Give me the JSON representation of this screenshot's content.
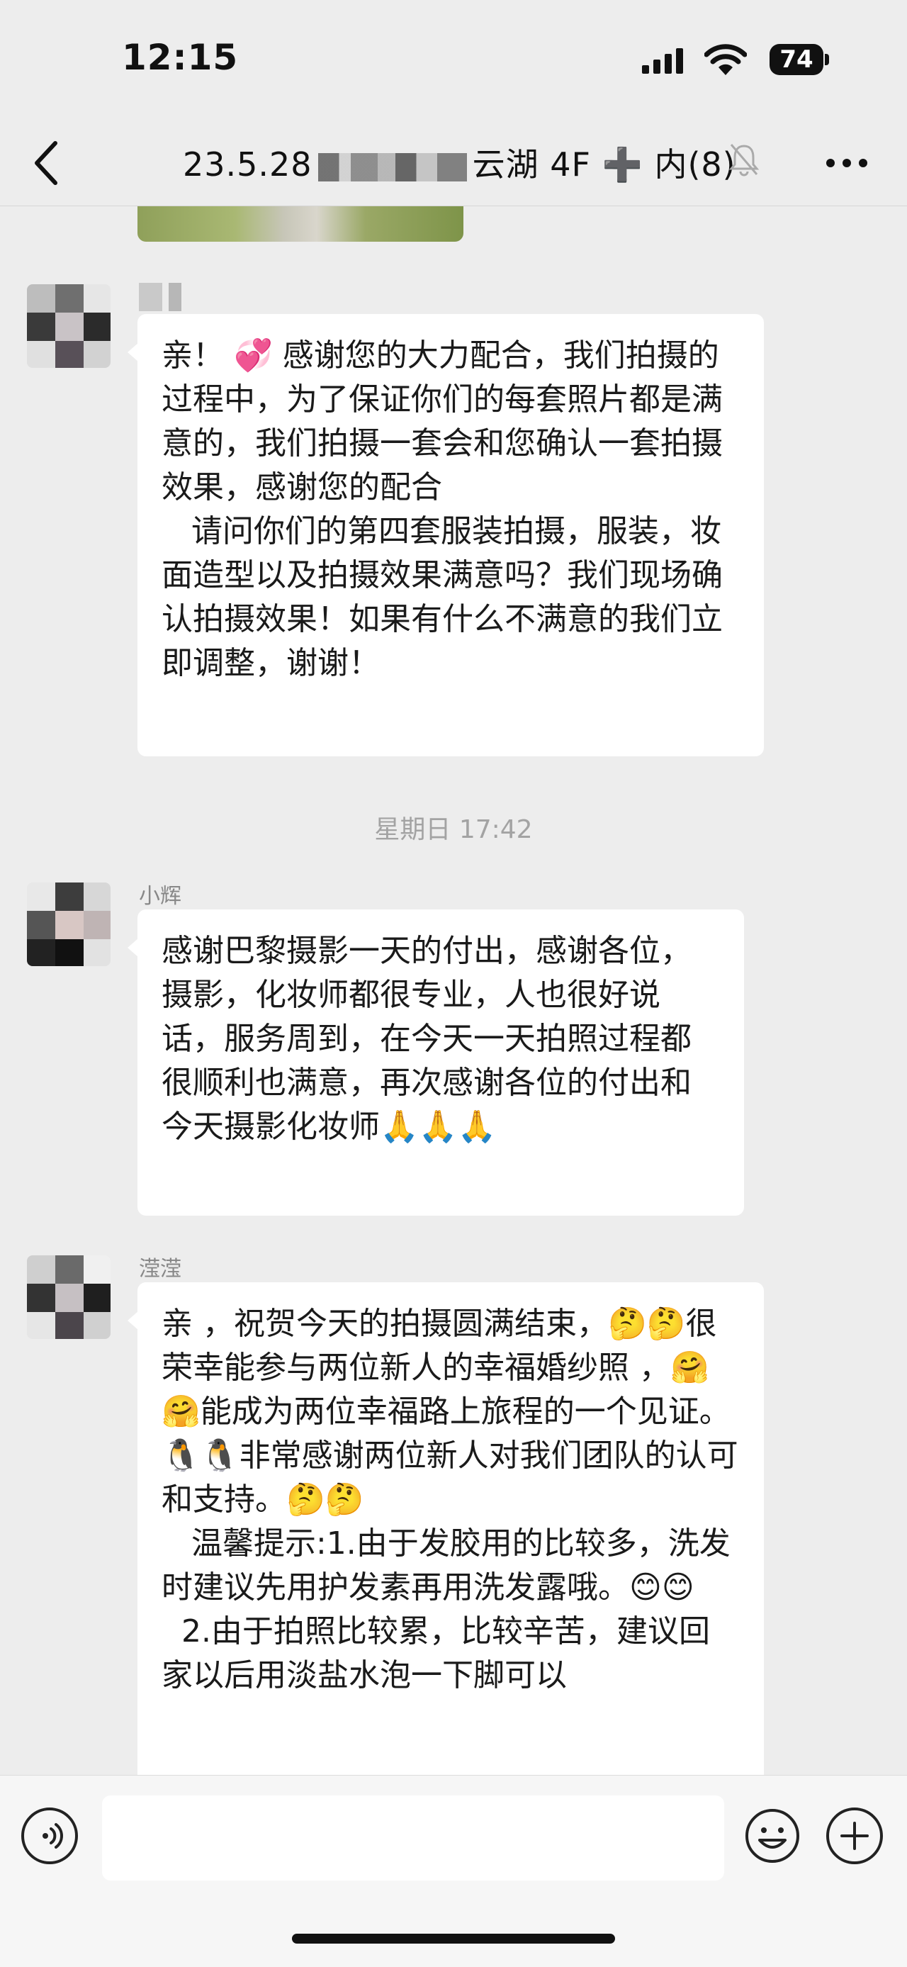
{
  "status_bar": {
    "time": "12:15",
    "battery": "74"
  },
  "nav": {
    "title_start": "23.5.28",
    "title_end": "云湖 4F ➕ 内(8)"
  },
  "messages": [
    {
      "sender": "",
      "text": "亲！ 💞 感谢您的大力配合，我们拍摄的过程中，为了保证你们的每套照片都是满意的，我们拍摄一套会和您确认一套拍摄效果，感谢您的配合\n   请问你们的第四套服装拍摄，服装，妆面造型以及拍摄效果满意吗？我们现场确认拍摄效果！如果有什么不满意的我们立即调整，谢谢！"
    },
    {
      "sender": "小辉",
      "text": "感谢巴黎摄影一天的付出，感谢各位，摄影，化妆师都很专业，人也很好说话，服务周到，在今天一天拍照过程都很顺利也满意，再次感谢各位的付出和今天摄影化妆师🙏🙏🙏"
    },
    {
      "sender": "滢滢",
      "text": "亲 ，祝贺今天的拍摄圆满结束，🤔🤔很荣幸能参与两位新人的幸福婚纱照 ，🤗🤗能成为两位幸福路上旅程的一个见证。🐧🐧非常感谢两位新人对我们团队的认可和支持。🤔🤔\n   温馨提示:1.由于发胶用的比较多，洗发时建议先用护发素再用洗发露哦。😊😊\n  2.由于拍照比较累，比较辛苦，建议回家以后用淡盐水泡一下脚可以"
    }
  ],
  "timestamp": "星期日 17:42",
  "icons": {
    "back": "chevron-left-icon",
    "mute": "bell-slash-icon",
    "more": "ellipsis-icon",
    "voice": "voice-icon",
    "emoji": "smiley-icon",
    "plus": "plus-icon"
  }
}
